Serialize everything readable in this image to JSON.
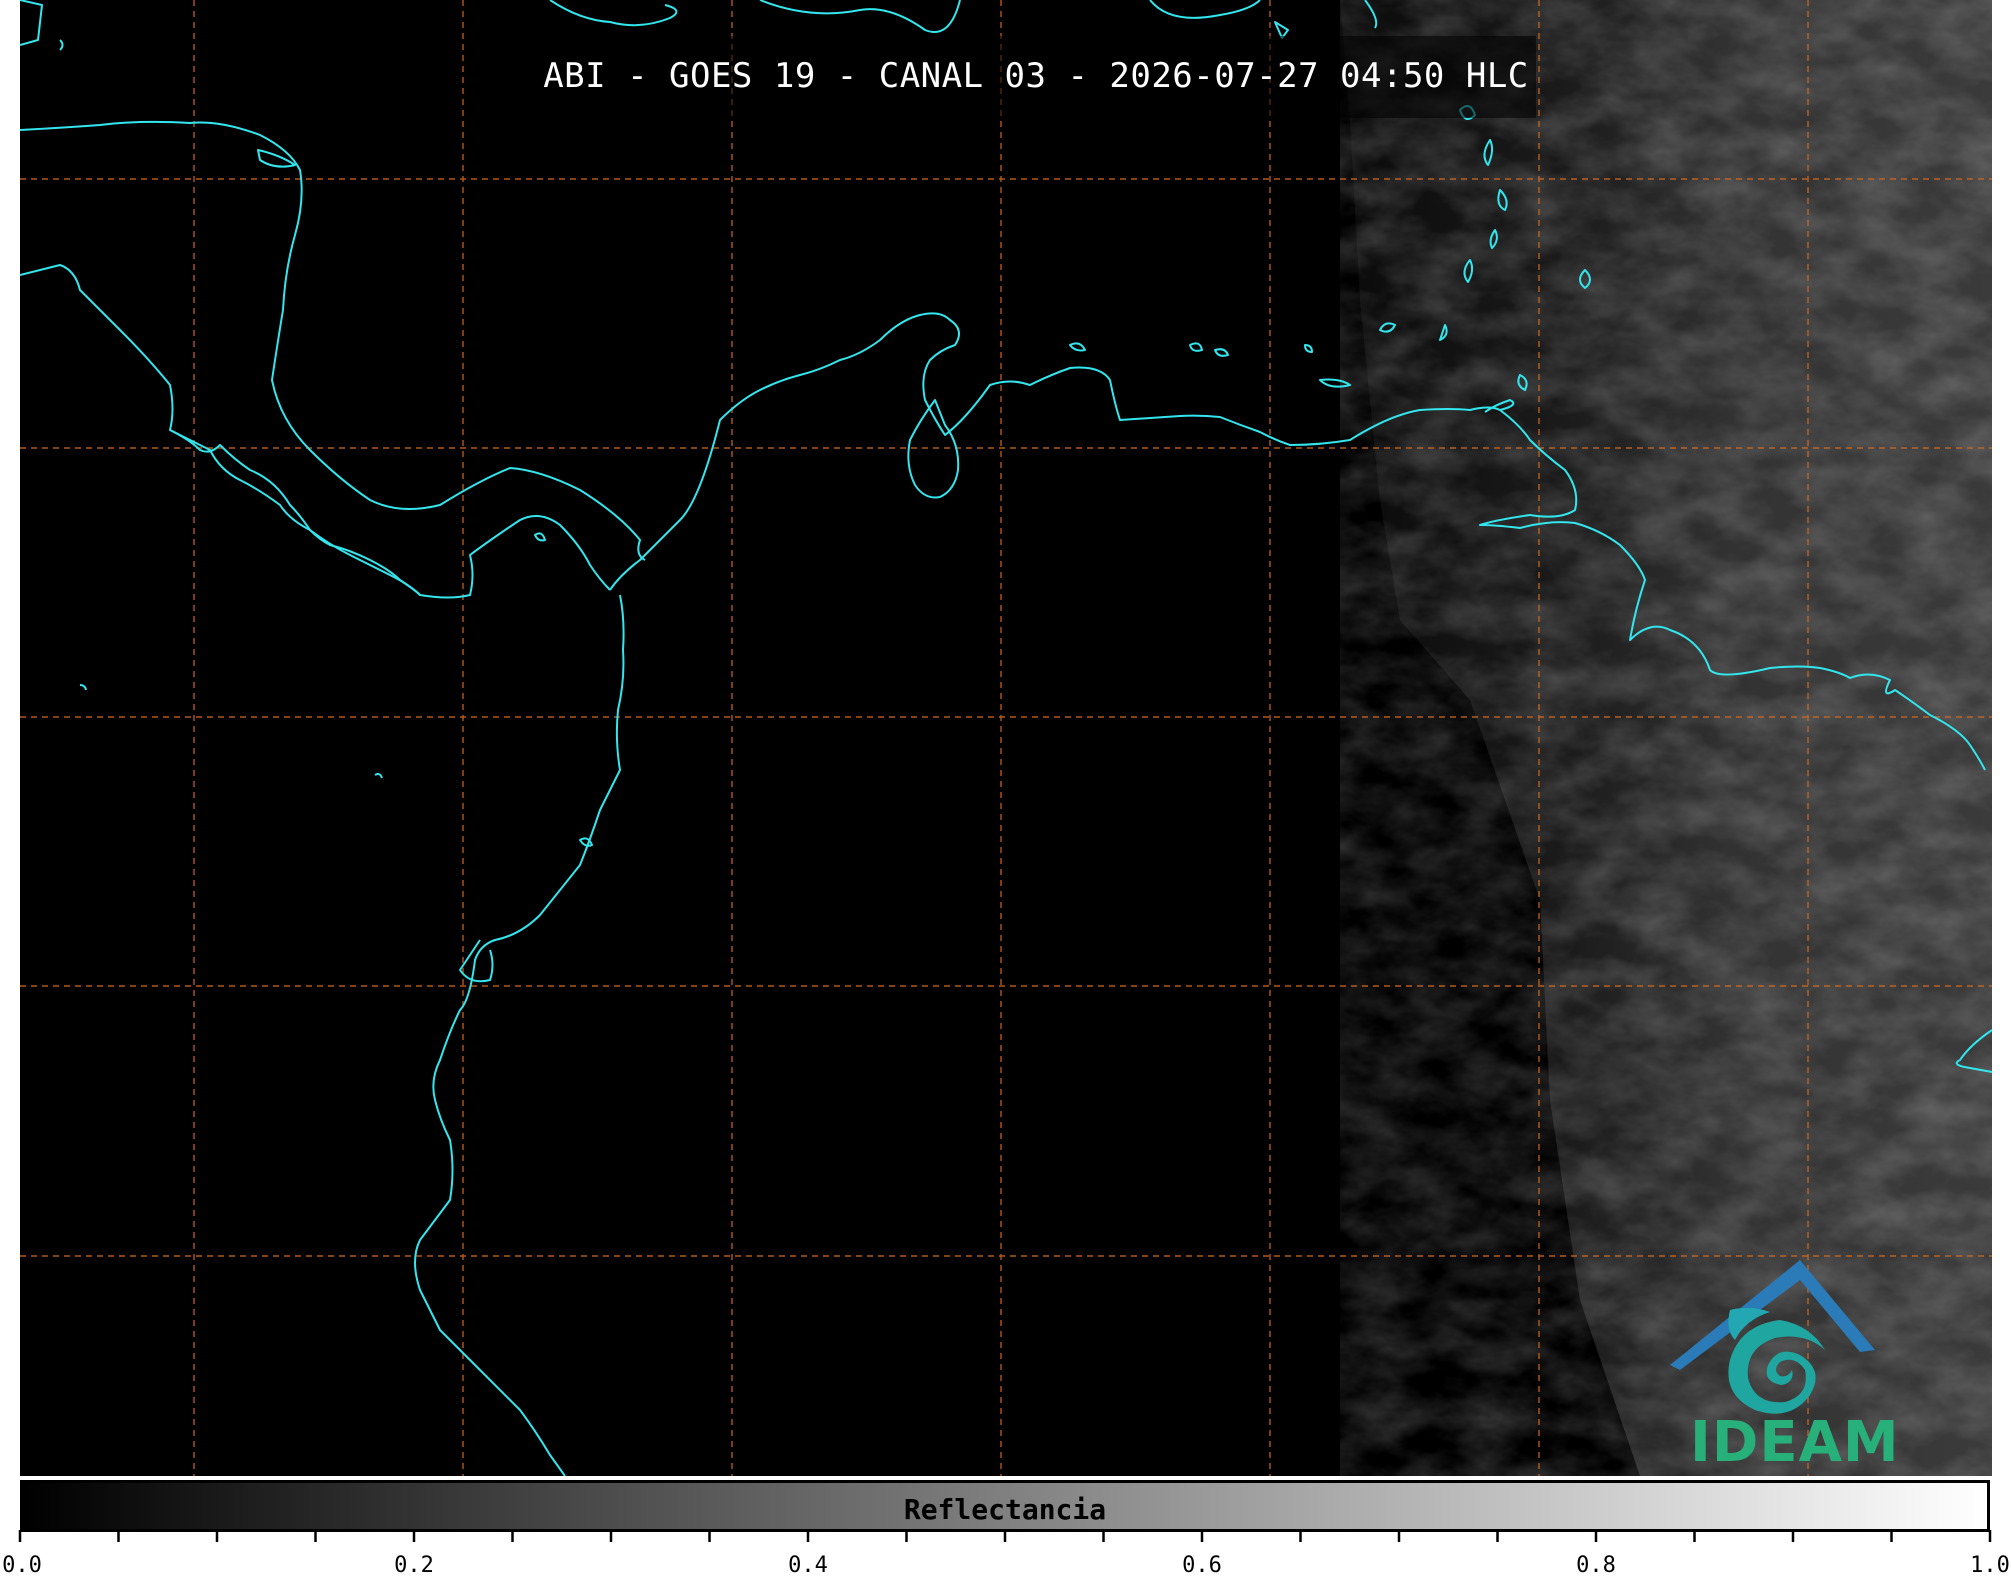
{
  "map": {
    "title": "ABI - GOES 19 - CANAL 03 - 2026-07-27 04:50 HLC",
    "background_color": "#000000",
    "coastline_color": "#33e6ee",
    "gridline_color": "#d2691e",
    "gridlines": "dashed, on"
  },
  "logo": {
    "text": "IDEAM",
    "icon": "ideam-logo-icon",
    "colors": {
      "roof": "#2a7bb8",
      "swirl": "#1fa6a0",
      "text": "#27b07a"
    }
  },
  "colorbar": {
    "label": "Reflectancia",
    "range": [
      0.0,
      1.0
    ],
    "colormap": "grayscale black-to-white",
    "tick_labels": [
      "0.0",
      "0.2",
      "0.4",
      "0.6",
      "0.8",
      "1.0"
    ],
    "tick_values": [
      0.0,
      0.2,
      0.4,
      0.6,
      0.8,
      1.0
    ],
    "minor_tick_step": 0.05
  }
}
